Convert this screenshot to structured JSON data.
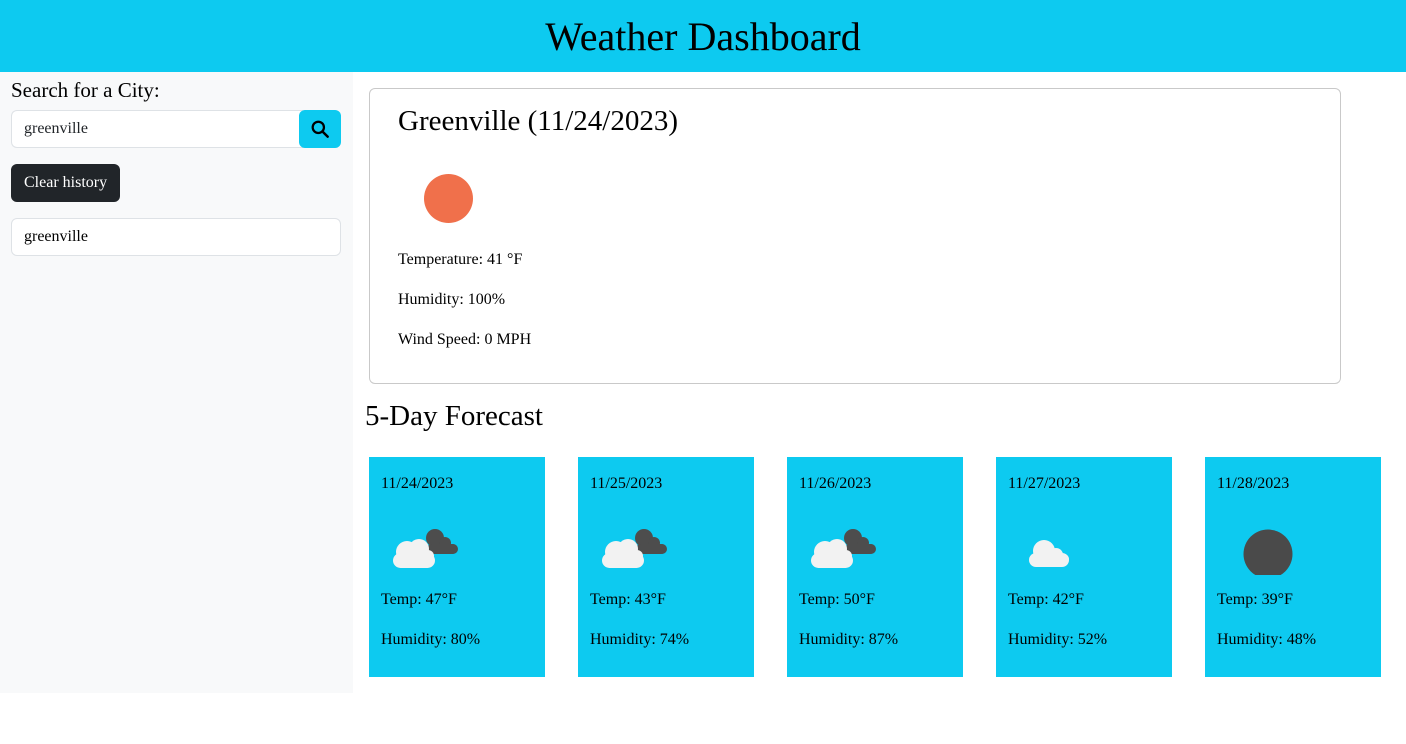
{
  "header": {
    "title": "Weather Dashboard"
  },
  "sidebar": {
    "search_label": "Search for a City:",
    "search_value": "greenville",
    "search_icon": "search-icon",
    "clear_label": "Clear history",
    "history": [
      {
        "label": "greenville"
      }
    ]
  },
  "current": {
    "title": "Greenville (11/24/2023)",
    "icon": "sun-icon",
    "icon_color": "#f0704b",
    "temperature": "Temperature: 41 °F",
    "humidity": "Humidity: 100%",
    "wind": "Wind Speed: 0 MPH"
  },
  "forecast": {
    "title": "5-Day Forecast",
    "days": [
      {
        "date": "11/24/2023",
        "icon": "broken-clouds-icon",
        "temp": "Temp: 47°F",
        "humidity": "Humidity: 80%"
      },
      {
        "date": "11/25/2023",
        "icon": "broken-clouds-icon",
        "temp": "Temp: 43°F",
        "humidity": "Humidity: 74%"
      },
      {
        "date": "11/26/2023",
        "icon": "broken-clouds-icon",
        "temp": "Temp: 50°F",
        "humidity": "Humidity: 87%"
      },
      {
        "date": "11/27/2023",
        "icon": "cloud-icon",
        "temp": "Temp: 42°F",
        "humidity": "Humidity: 52%"
      },
      {
        "date": "11/28/2023",
        "icon": "moon-icon",
        "temp": "Temp: 39°F",
        "humidity": "Humidity: 48%"
      }
    ]
  },
  "colors": {
    "accent": "#0dcaf0",
    "sidebar_bg": "#f8f9fa",
    "dark_button": "#212529"
  }
}
